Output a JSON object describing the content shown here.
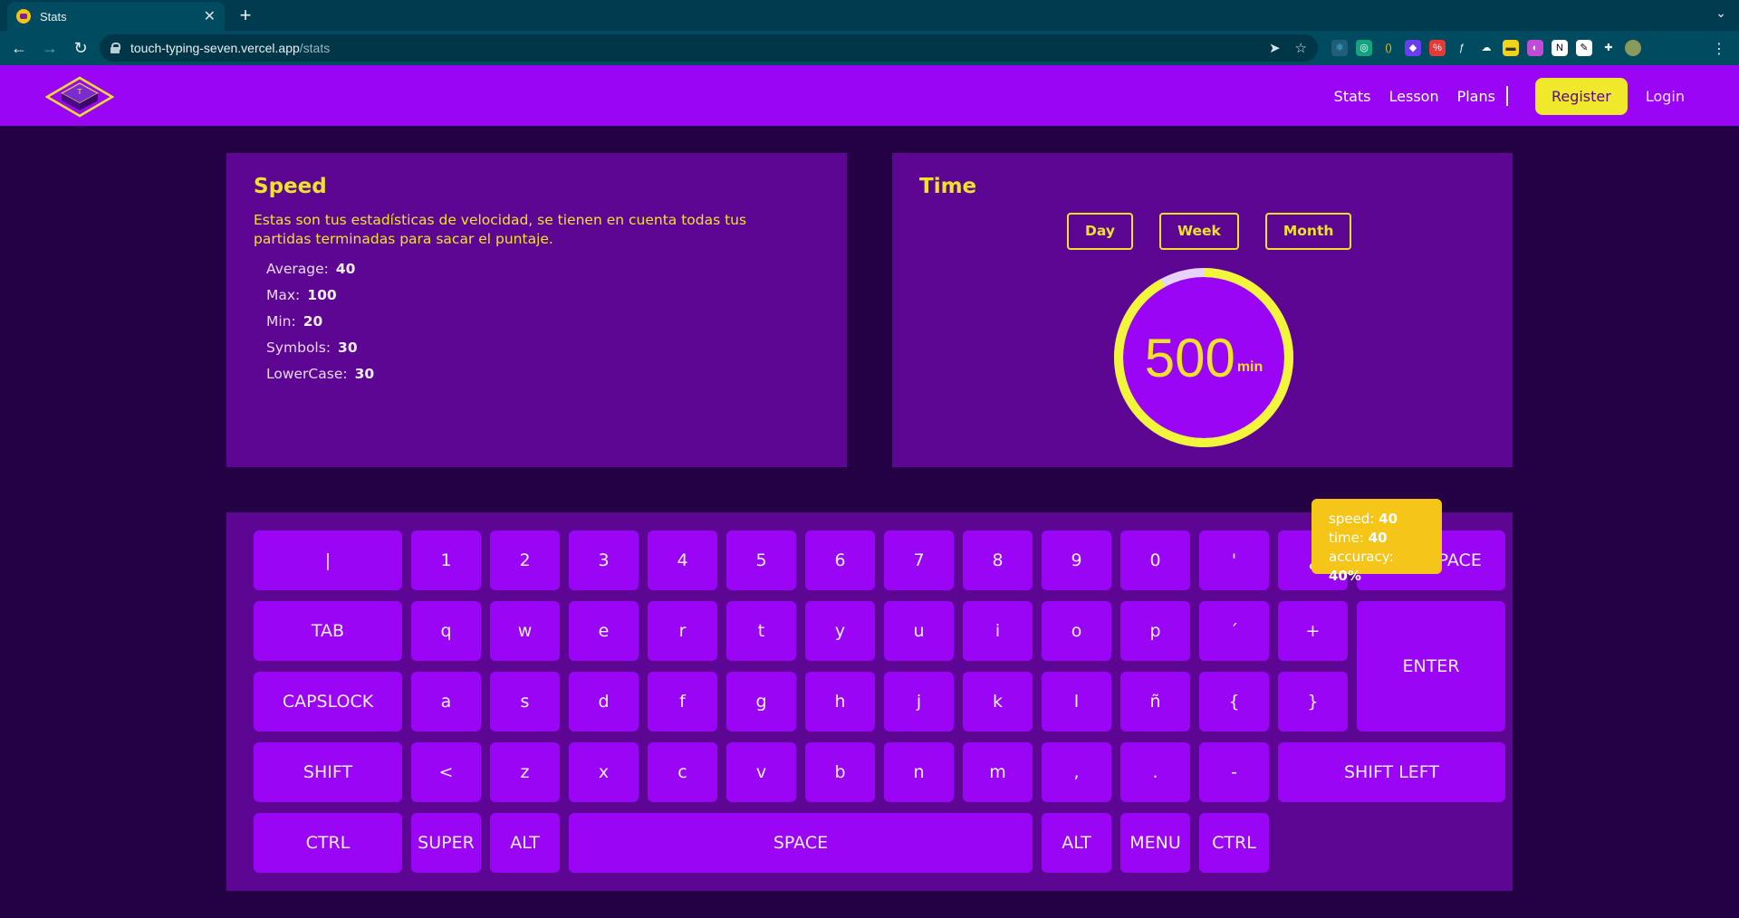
{
  "browser": {
    "tab_title": "Stats",
    "url_host": "touch-typing-seven.vercel.app",
    "url_path": "/stats"
  },
  "nav": {
    "links": [
      "Stats",
      "Lesson",
      "Plans"
    ],
    "register_label": "Register",
    "login_label": "Login"
  },
  "speed": {
    "title": "Speed",
    "description": "Estas son tus estadísticas de velocidad, se tienen en cuenta todas tus partidas terminadas para sacar el puntaje.",
    "stats": [
      {
        "label": "Average:",
        "value": "40"
      },
      {
        "label": "Max:",
        "value": "100"
      },
      {
        "label": "Min:",
        "value": "20"
      },
      {
        "label": "Symbols:",
        "value": "30"
      },
      {
        "label": "LowerCase:",
        "value": "30"
      }
    ]
  },
  "time": {
    "title": "Time",
    "periods": [
      "Day",
      "Week",
      "Month"
    ],
    "value": "500",
    "unit": "min",
    "progress_fraction": 0.92
  },
  "keyboard": {
    "rows": [
      [
        "|",
        "1",
        "2",
        "3",
        "4",
        "5",
        "6",
        "7",
        "8",
        "9",
        "0",
        "'",
        "¿",
        "BACKSPACE"
      ],
      [
        "TAB",
        "q",
        "w",
        "e",
        "r",
        "t",
        "y",
        "u",
        "i",
        "o",
        "p",
        "´",
        "+",
        "ENTER"
      ],
      [
        "CAPSLOCK",
        "a",
        "s",
        "d",
        "f",
        "g",
        "h",
        "j",
        "k",
        "l",
        "ñ",
        "{",
        "}"
      ],
      [
        "SHIFT",
        "<",
        "z",
        "x",
        "c",
        "v",
        "b",
        "n",
        "m",
        ",",
        ".",
        "-",
        "SHIFT LEFT"
      ],
      [
        "CTRL",
        "SUPER",
        "ALT",
        "SPACE",
        "ALT",
        "MENU",
        "CTRL"
      ]
    ]
  },
  "tooltip": {
    "speed_label": "speed:",
    "speed_value": "40",
    "time_label": "time:",
    "time_value": "40",
    "accuracy_label": "accuracy:",
    "accuracy_value": "40%"
  },
  "colors": {
    "accent": "#9a05f5",
    "panel": "#5d0694",
    "background": "#240045",
    "highlight": "#f0e22a",
    "tooltip": "#f5c518"
  }
}
